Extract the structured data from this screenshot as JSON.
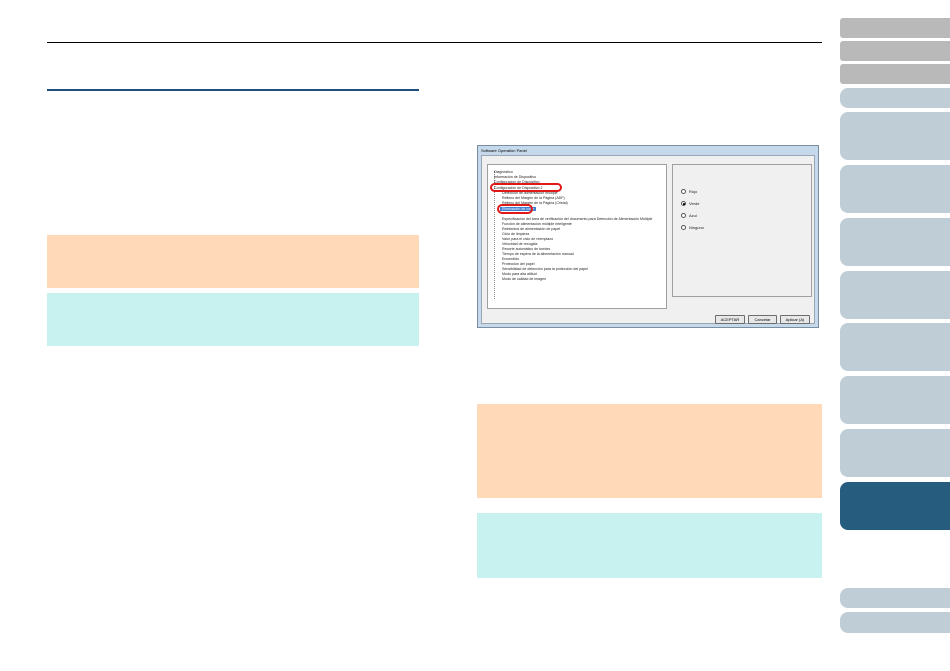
{
  "dialog": {
    "title": "Software Operation Panel",
    "tree_items": [
      "Diagnóstico",
      "Información de Dispositivo",
      "Configuración de Dispositivo",
      "Configuración de Dispositivo 2",
      "Detección de alimentación múltiple",
      "Relleno del Margen de la Página (ADF)",
      "Relleno del Margen de la Página (Cristal)",
      "Eliminación de color",
      "Especificación del área de verificación del documento para Detección de Alimentación Múltiple",
      "Función de alimentación múltiple inteligente",
      "Reintentos de alimentación de papel",
      "Ciclo de limpieza",
      "Valor para el ciclo de reemplazo",
      "Velocidad de recogida",
      "Recorte automático de bordes",
      "Tiempo de espera de la alimentación manual",
      "Encendido",
      "Protección del papel",
      "Sensibilidad de detección para la protección del papel",
      "Modo para alta altitud",
      "Modo de calidad de imagen"
    ],
    "selected_item": "Eliminación de color",
    "radio_options": [
      "Rojo",
      "Verde",
      "Azul",
      "Ninguno"
    ],
    "selected_radio": "Verde",
    "buttons": {
      "ok": "ACEPTAR",
      "cancel": "Cancelar",
      "apply": "Aplicar (A)"
    }
  },
  "colors": {
    "note_orange": "#ffd9b8",
    "note_cyan": "#c8f2f0",
    "tab_light": "#bfcdd7",
    "tab_gray": "#b9b9b9",
    "tab_active": "#265c7e",
    "rule_blue": "#1e4f7a",
    "highlight_red": "#e01818"
  },
  "side_tabs": {
    "active_index": 8
  }
}
